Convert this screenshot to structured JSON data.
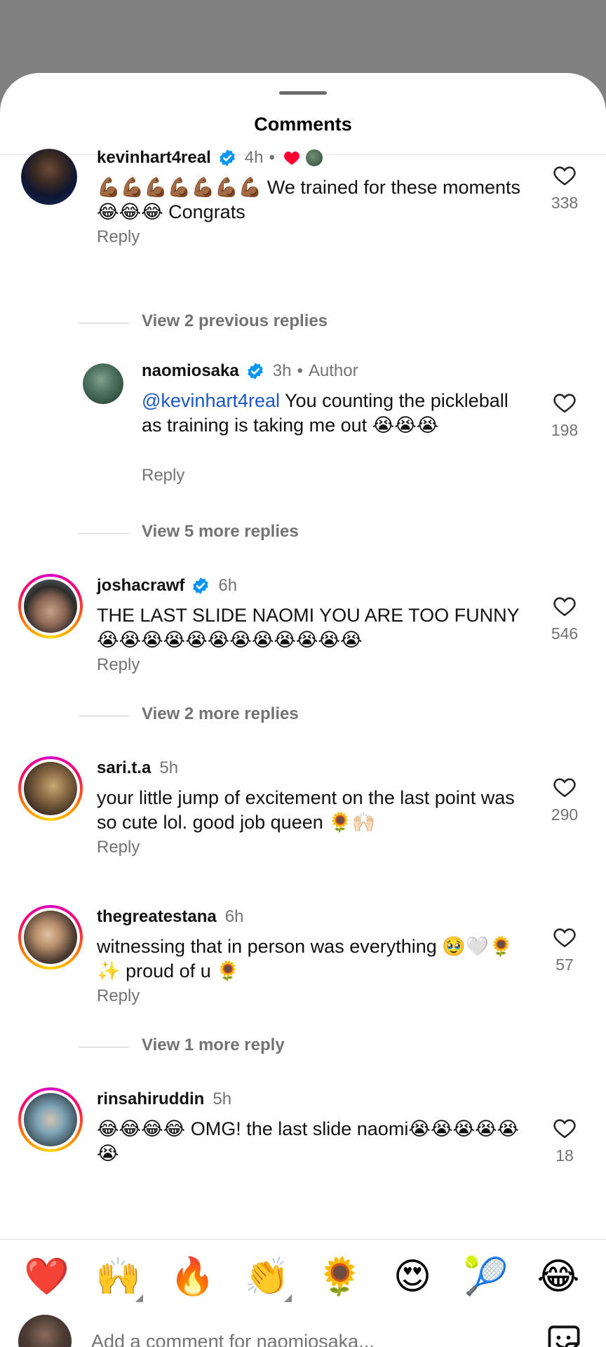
{
  "sheet": {
    "title": "Comments"
  },
  "comments": [
    {
      "username": "kevinhart4real",
      "verified": true,
      "time": "4h",
      "text": "💪🏾💪🏾💪🏾💪🏾💪🏾💪🏾💪🏾 We trained for these moments 😂😂😂 Congrats",
      "reply_label": "Reply",
      "likes": "338"
    },
    {
      "username": "naomiosaka",
      "verified": true,
      "time": "3h",
      "author_label": "Author",
      "mention": "@kevinhart4real",
      "text": " You counting the pickleball as training is taking me out 😭😭😭",
      "reply_label": "Reply",
      "likes": "198"
    },
    {
      "username": "joshacrawf",
      "verified": true,
      "time": "6h",
      "text": "THE LAST SLIDE NAOMI YOU ARE TOO FUNNY😭😭😭😭😭😭😭😭😭😭😭😭",
      "reply_label": "Reply",
      "likes": "546"
    },
    {
      "username": "sari.t.a",
      "verified": false,
      "time": "5h",
      "text": "your little jump of excitement on the last point was so cute lol. good job queen 🌻🙌🏻",
      "reply_label": "Reply",
      "likes": "290"
    },
    {
      "username": "thegreatestana",
      "verified": false,
      "time": "6h",
      "text": "witnessing that in person was everything 🥹🤍🌻✨ proud of u 🌻",
      "reply_label": "Reply",
      "likes": "57"
    },
    {
      "username": "rinsahiruddin",
      "verified": false,
      "time": "5h",
      "text": "😂😂😂😂 OMG! the last slide naomi😭😭😭😭😭😭",
      "likes": "18"
    }
  ],
  "view_more": [
    "View 2 previous replies",
    "View 5 more replies",
    "View 2 more replies",
    "View 1 more reply"
  ],
  "quick_emojis": [
    "❤️",
    "🙌",
    "🔥",
    "👏",
    "🌻",
    "😍",
    "🎾",
    "😂"
  ],
  "composer": {
    "placeholder": "Add a comment for naomiosaka..."
  },
  "colors": {
    "verified": "#0095f6",
    "mention": "#1a56c8",
    "secondary": "#737373",
    "heart": "#ff0033"
  }
}
